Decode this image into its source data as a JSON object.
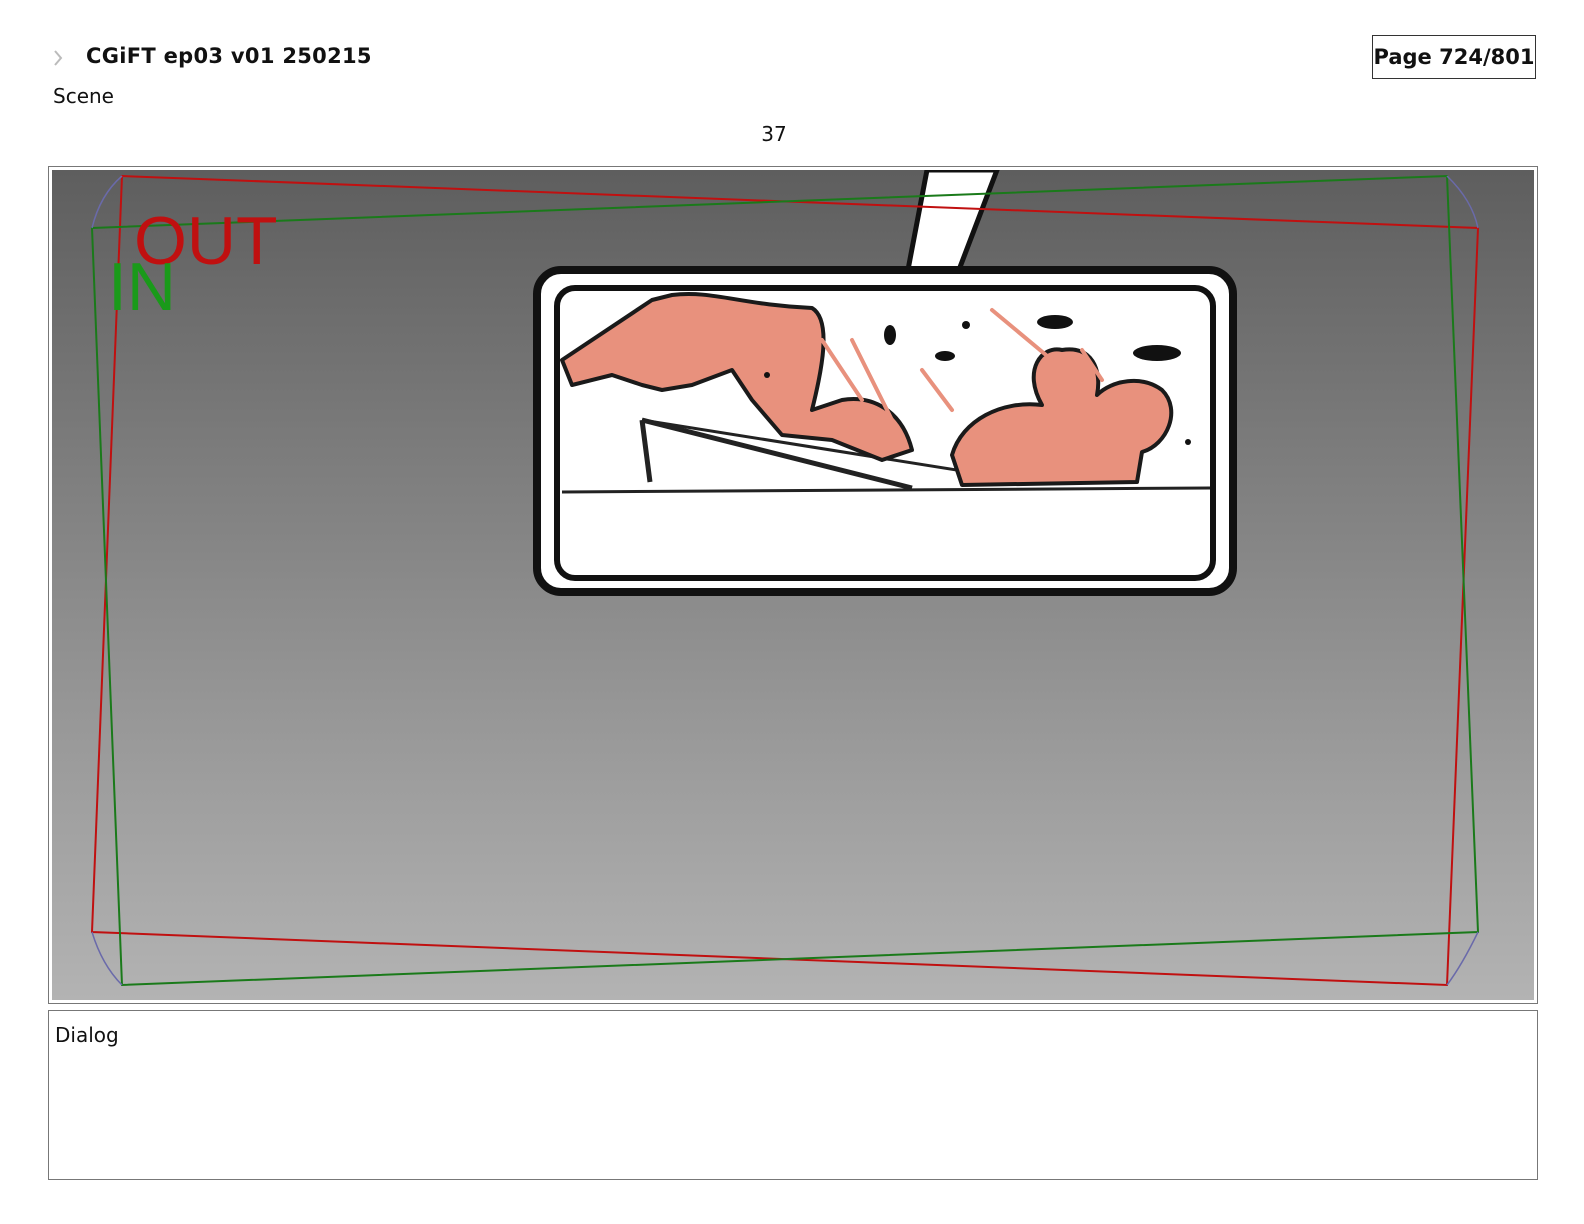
{
  "header": {
    "title": "CGiFT ep03 v01 250215",
    "page": "Page 724/801",
    "icon": "arrow-icon"
  },
  "scene": {
    "label": "Scene",
    "number": "37"
  },
  "panel": {
    "in_label": "IN",
    "out_label": "OUT",
    "in_color": "#1a8a1a",
    "out_color": "#c01010",
    "skin_color": "#e8917d"
  },
  "dialog": {
    "label": "Dialog"
  }
}
